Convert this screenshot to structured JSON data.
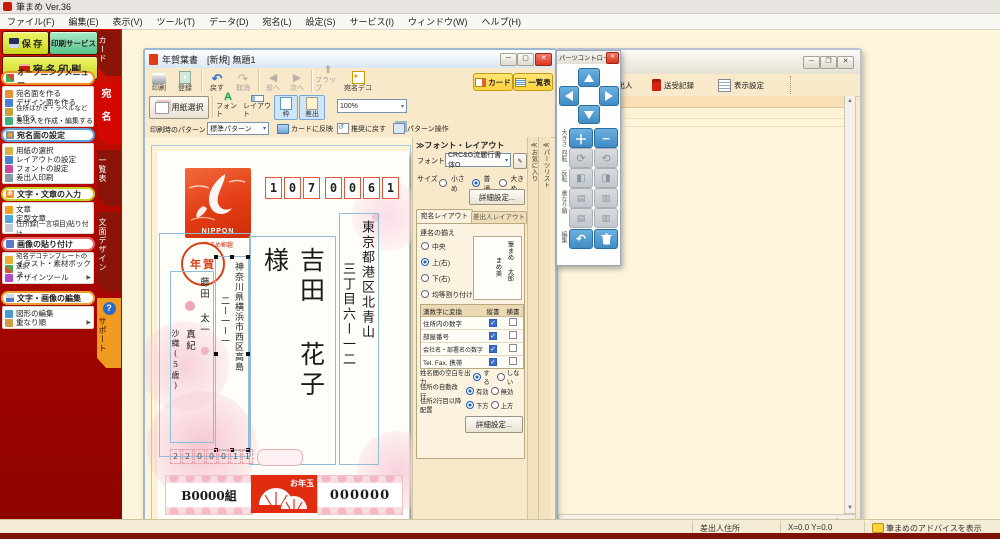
{
  "app": {
    "title": "筆まめ Ver.36"
  },
  "menubar": {
    "items": [
      "ファイル(F)",
      "編集(E)",
      "表示(V)",
      "ツール(T)",
      "データ(D)",
      "宛名(L)",
      "設定(S)",
      "サービス(I)",
      "ウィンドウ(W)",
      "ヘルプ(H)"
    ]
  },
  "sidebar": {
    "save": "保 存",
    "print_service": "印刷サービス",
    "atena_print": "宛 名 印 刷",
    "sections": [
      {
        "title": "オープニングメニュー",
        "items": [
          "宛名面を作る",
          "デザイン面を作る",
          "住所はがき・ラベルなどを作る",
          "差出人を作成・編集する"
        ]
      },
      {
        "title": "宛名面の設定",
        "items": [
          "用紙の選択",
          "レイアウトの設定",
          "フォントの設定",
          "差出人印刷"
        ]
      },
      {
        "title": "文字・文章の入力",
        "items": [
          "文章",
          "定型文章",
          "住所録(一言項目)貼り付け"
        ]
      },
      {
        "title": "画像の貼り付け",
        "items": [
          "宛名デコテンプレートの選択",
          "イラスト・素材ボックス",
          "デザインツール"
        ]
      },
      {
        "title": "文字・画像の編集",
        "items": [
          "図形の編集",
          "重なり順"
        ]
      }
    ]
  },
  "side_tabs": {
    "card": "カード",
    "atena": "宛 名",
    "list": "一覧表",
    "design": "文面デザイン",
    "support": "サポート",
    "support_icon": "?"
  },
  "card_window": {
    "title": "年賀葉書　[新規] 無題1",
    "tools1": [
      "印刷",
      "登録",
      "戻す",
      "取消",
      "前へ",
      "次へ",
      "フラップ",
      "宛名デコ"
    ],
    "view_card": "カード",
    "view_list": "一覧表",
    "paper_select": "用紙選択",
    "tools2": [
      "フォント",
      "レイアウト",
      "枠",
      "差出"
    ],
    "zoom": "100%",
    "pattern_label": "印刷時のパターン",
    "pattern_value": "標準パターン",
    "pattern_buttons": [
      "カードに反映",
      "推奨に戻す",
      "パターン操作"
    ]
  },
  "postcard": {
    "postal_digits": [
      "1",
      "0",
      "7",
      "0",
      "0",
      "6",
      "1"
    ],
    "stamp_caption": "NIPPON",
    "stamp_sub": "筆まめ郵趣",
    "nenga": "年賀",
    "recipient": "吉田 花子 様",
    "addr_col1": "東京都港区北青山",
    "addr_col2": "三丁目六ー一二",
    "sender_addr_col1": "神奈川県横浜市西区高島",
    "sender_addr_col2": "二ー一ー一",
    "sender_family": "藤田 太一",
    "sender_name2": "真紀",
    "sender_name3": "沙織(5歳)",
    "sender_postal_digits": [
      "2",
      "2",
      "0",
      "0",
      "0",
      "1",
      "1"
    ],
    "lottery_left": "B0000組",
    "otoshidama": "お年玉",
    "lottery_right": "000000"
  },
  "settings": {
    "header": "≫フォント・レイアウト",
    "font_label": "フォント",
    "font_value": "CRC&G流麗行書体O",
    "size_label": "サイズ",
    "size_small": "小さめ",
    "size_normal": "普通",
    "size_large": "大きめ",
    "detail1": "詳細設定...",
    "tab_atena": "宛名レイアウト",
    "tab_sender": "差出人レイアウト",
    "renmei_label": "連名の揃え",
    "renmei_center": "中央",
    "renmei_top": "上(右)",
    "renmei_bottom": "下(右)",
    "renmei_even": "均等割り付け",
    "preview_col1": "筆まめ 太郎",
    "preview_col2": "まめ美",
    "kansuji_header": "漢数字に変換",
    "col_tate": "縦書",
    "col_yoko": "横書",
    "kansuji_rows": [
      "住所内の数字",
      "部屋番号",
      "会社名・部署名の数字",
      "Tel. Fax. 携帯"
    ],
    "opt1_label": "姓名間の空白を出力",
    "opt1_a": "する",
    "opt1_b": "しない",
    "opt2_label": "住所の自動改行",
    "opt2_a": "有効",
    "opt2_b": "無効",
    "opt3_label": "住所2行目以降配置",
    "opt3_a": "下方",
    "opt3_b": "上方",
    "detail2": "詳細設定..."
  },
  "right_tabs": {
    "favorites": "≪お気に入り",
    "parts": "≪パーツリスト"
  },
  "parts_controller": {
    "title": "パーツコントローラ",
    "label_size": "大きさ",
    "label_rotate": "回転",
    "label_flip": "反転",
    "label_order": "重なり順",
    "label_edit": "編集"
  },
  "list_window": {
    "btn_atena_sender": "宛名,差出人",
    "btn_record": "送受記録",
    "btn_display": "表示設定"
  },
  "statusbar": {
    "field": "差出人住所",
    "coords": "X=0.0 Y=0.0",
    "advice": "筆まめのアドバイスを表示"
  },
  "colors": {
    "sidebar_red": "#ad0700",
    "active_tab_red": "#d40800",
    "support_orange": "#f09c20",
    "view_button_yellow": "#ffd23c",
    "controller_blue": "#3f8cc4",
    "stamp_red": "#e23c14"
  }
}
